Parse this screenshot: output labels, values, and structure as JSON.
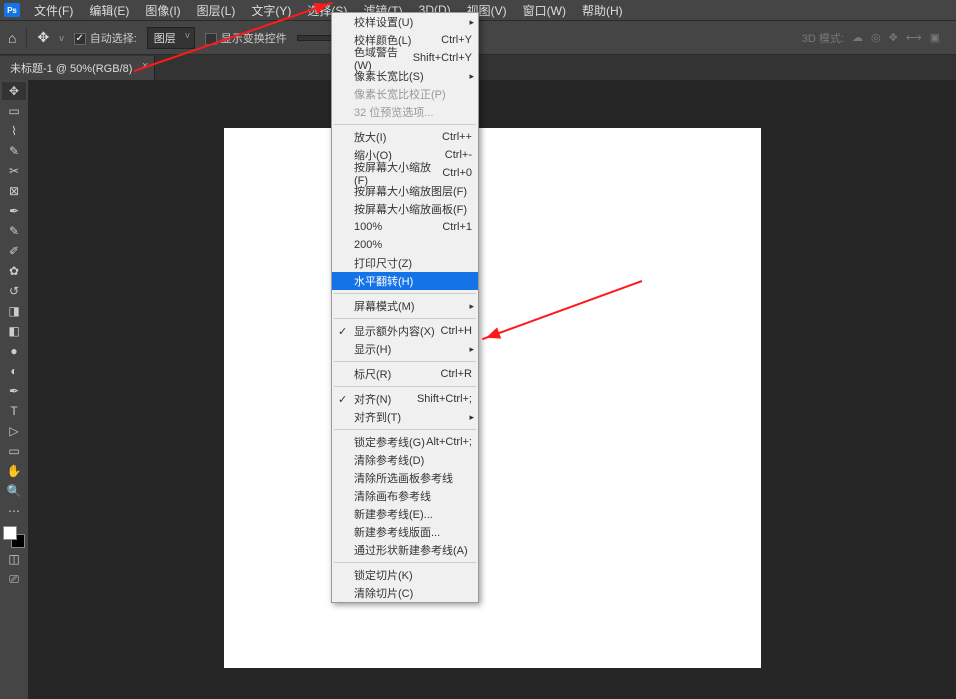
{
  "menubar": {
    "items": [
      "文件(F)",
      "编辑(E)",
      "图像(I)",
      "图层(L)",
      "文字(Y)",
      "选择(S)",
      "滤镜(T)",
      "3D(D)",
      "视图(V)",
      "窗口(W)",
      "帮助(H)"
    ]
  },
  "options": {
    "auto_select_label": "自动选择:",
    "layer_dropdown": "图层",
    "show_transform_label": "显示变换控件",
    "three_d_label": "3D 模式:"
  },
  "tab": {
    "title": "未标题-1 @ 50%(RGB/8)"
  },
  "view_menu": {
    "items": [
      {
        "label": "校样设置(U)",
        "shortcut": "",
        "submenu": true
      },
      {
        "label": "校样颜色(L)",
        "shortcut": "Ctrl+Y"
      },
      {
        "label": "色域警告(W)",
        "shortcut": "Shift+Ctrl+Y"
      },
      {
        "label": "像素长宽比(S)",
        "shortcut": "",
        "submenu": true
      },
      {
        "label": "像素长宽比校正(P)",
        "shortcut": "",
        "disabled": true
      },
      {
        "label": "32 位预览选项...",
        "shortcut": "",
        "disabled": true
      },
      {
        "sep": true
      },
      {
        "label": "放大(I)",
        "shortcut": "Ctrl++"
      },
      {
        "label": "缩小(O)",
        "shortcut": "Ctrl+-"
      },
      {
        "label": "按屏幕大小缩放(F)",
        "shortcut": "Ctrl+0"
      },
      {
        "label": "按屏幕大小缩放图层(F)",
        "shortcut": ""
      },
      {
        "label": "按屏幕大小缩放画板(F)",
        "shortcut": ""
      },
      {
        "label": "100%",
        "shortcut": "Ctrl+1"
      },
      {
        "label": "200%",
        "shortcut": ""
      },
      {
        "label": "打印尺寸(Z)",
        "shortcut": ""
      },
      {
        "label": "水平翻转(H)",
        "shortcut": "",
        "highlighted": true
      },
      {
        "sep": true
      },
      {
        "label": "屏幕模式(M)",
        "shortcut": "",
        "submenu": true
      },
      {
        "sep": true
      },
      {
        "label": "显示额外内容(X)",
        "shortcut": "Ctrl+H",
        "checked": true
      },
      {
        "label": "显示(H)",
        "shortcut": "",
        "submenu": true
      },
      {
        "sep": true
      },
      {
        "label": "标尺(R)",
        "shortcut": "Ctrl+R"
      },
      {
        "sep": true
      },
      {
        "label": "对齐(N)",
        "shortcut": "Shift+Ctrl+;",
        "checked": true
      },
      {
        "label": "对齐到(T)",
        "shortcut": "",
        "submenu": true
      },
      {
        "sep": true
      },
      {
        "label": "锁定参考线(G)",
        "shortcut": "Alt+Ctrl+;"
      },
      {
        "label": "清除参考线(D)",
        "shortcut": ""
      },
      {
        "label": "清除所选画板参考线",
        "shortcut": ""
      },
      {
        "label": "清除画布参考线",
        "shortcut": ""
      },
      {
        "label": "新建参考线(E)...",
        "shortcut": ""
      },
      {
        "label": "新建参考线版面...",
        "shortcut": ""
      },
      {
        "label": "通过形状新建参考线(A)",
        "shortcut": ""
      },
      {
        "sep": true
      },
      {
        "label": "锁定切片(K)",
        "shortcut": ""
      },
      {
        "label": "清除切片(C)",
        "shortcut": ""
      }
    ]
  }
}
